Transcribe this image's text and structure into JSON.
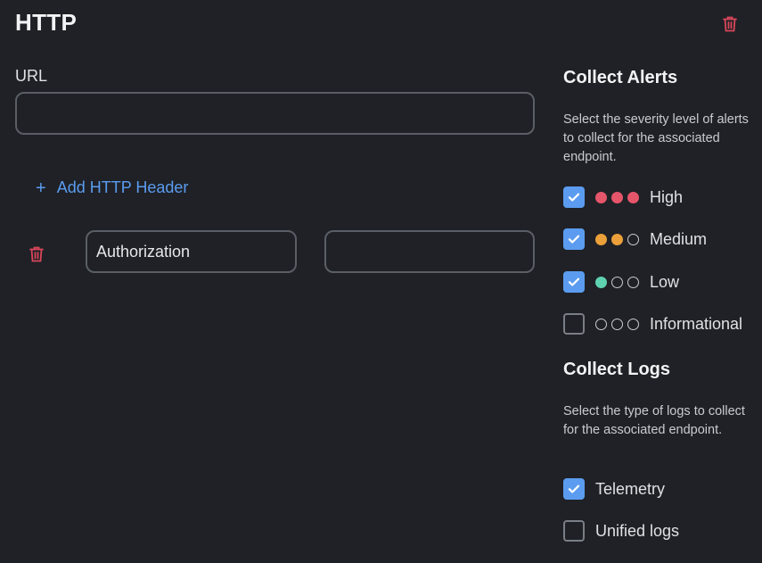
{
  "title": "HTTP",
  "url_field": {
    "label": "URL",
    "value": "",
    "placeholder": ""
  },
  "add_header_label": "Add HTTP Header",
  "header_row": {
    "name_value": "Authorization",
    "value_value": ""
  },
  "alerts": {
    "title": "Collect Alerts",
    "description": "Select the severity level of alerts to collect for the associated endpoint.",
    "options": [
      {
        "label": "High",
        "checked": true,
        "filled_dots": 3,
        "color": "#e5566b"
      },
      {
        "label": "Medium",
        "checked": true,
        "filled_dots": 2,
        "color": "#eba03a"
      },
      {
        "label": "Low",
        "checked": true,
        "filled_dots": 1,
        "color": "#5fd2b0"
      },
      {
        "label": "Informational",
        "checked": false,
        "filled_dots": 0,
        "color": "#c9cbd0"
      }
    ]
  },
  "logs": {
    "title": "Collect Logs",
    "description": "Select the type of logs to collect for the associated endpoint.",
    "options": [
      {
        "label": "Telemetry",
        "checked": true
      },
      {
        "label": "Unified logs",
        "checked": false
      }
    ]
  },
  "colors": {
    "accent": "#5b9cf0",
    "danger": "#d9465a",
    "background": "#1f2126"
  },
  "icons": {
    "delete": "trash-icon",
    "add": "plus-icon",
    "check": "checkmark-icon"
  }
}
